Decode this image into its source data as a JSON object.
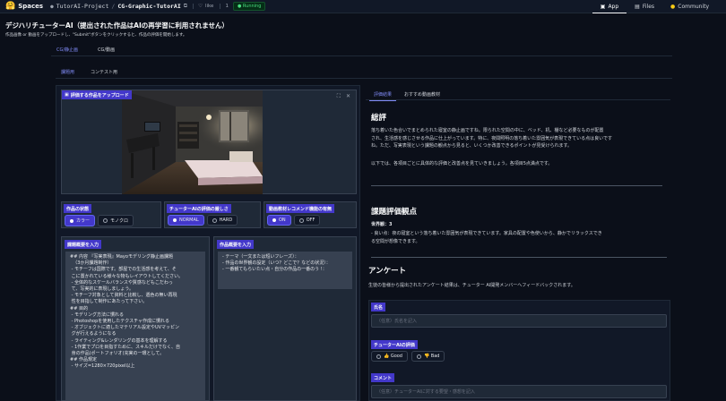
{
  "topbar": {
    "logo_icon": "hugging-face-emoji",
    "brand": "Spaces",
    "owner": "TutorAI-Project",
    "separator": "/",
    "space_name": "CG-Graphic-TutorAI",
    "copy_icon": "copy-icon",
    "like_label": "like",
    "like_count": "1",
    "status": "Running",
    "nav": [
      {
        "label": "App",
        "icon": "app-icon"
      },
      {
        "label": "Files",
        "icon": "files-icon"
      },
      {
        "label": "Community",
        "icon": "community-icon"
      }
    ]
  },
  "app": {
    "title": "デジハリチューターAI（提出された作品はAIの再学習に利用されません）",
    "description": "作品画像 or 動画をアップロードし、\"Submit\"ボタンをクリックすると、作品の評価を開始します。"
  },
  "tabs_main": [
    "CG/静止画",
    "CG/動画"
  ],
  "tabs_sub": [
    "課題用",
    "コンテスト用"
  ],
  "upload": {
    "label": "評価する作品をアップロード",
    "label_icon": "image-icon",
    "fullscreen_icon": "fullscreen-icon",
    "close_icon": "close-icon"
  },
  "radios": {
    "state": {
      "label": "作品の状態",
      "options": [
        "カラー",
        "モノクロ"
      ],
      "selected": 0
    },
    "strictness": {
      "label": "チューターAIの評価の厳しさ",
      "options": [
        "NORMAL",
        "HARD"
      ],
      "selected": 0
    },
    "video": {
      "label": "動画教材レコメンド機能の有無",
      "options": [
        "ON",
        "OFF"
      ],
      "selected": 0
    }
  },
  "assignment": {
    "label": "課題概要を入力",
    "text": "## 内容 『写実表現』Mayoモデリング静止画課題\n  （3か月課題制作）\n - モチーフは国際です。部屋での生活感を考えて、そ\n こに置かれている様々な物もレイアウトしてください。\n - 全体的なスケールバランスや質感などもこだわっ\n て、写実的に表現しましょう。\n - モチーフ対象として資料と比較し、遜色の無い再現\n 性を目指して制作にあたって下さい。\n## 目的\n - モデリング方法に慣れる\n - Photoshopを使用したテクスチャ作成に慣れる\n - オブジェクトに適したマテリアル設定やUVマッピン\n グが行えるようになる\n - ライティング&レンダリングの基本を理解する\n - 1作業でプロを目指すために、スキルだけでなく、自\n 身の作品(ポートフォリオ)充実の一環として。\n## 作品規定\n - サイズ=1280×720pixel以上"
  },
  "work": {
    "label": "作品概要を入力",
    "text": "- テーマ（一文または短いフレーズ）：\n- 作品の世界観の設定（いつ？どこで？などの状況）：\n- 一番観てもらいたい点・自分の作品の一番のう !："
  },
  "right_tabs": [
    "評価結果",
    "おすすめ動画教材"
  ],
  "result": {
    "h_summary": "総評",
    "summary": "落ち着いた色合いでまとめられた寝室の静止画ですね。限られた空間の中に、ベッド、机、棚など必要なものが配置\nされ、生活感を感じさせる作品に仕上がっています。特に、夜間照明の落ち着いた雰囲気が表現できている点は良いです\nね。ただ、写実表現という課題の観点から見ると、いくつか改善できるポイントが見受けられます。",
    "summary_end": "以下では、各項目ごとに具体的な評価と改善点を見ていきましょう。各項目5点満点です。",
    "h_points": "課題評価観点",
    "point_title": "世界観：3",
    "point_text": "- 良い点：夜の寝室という落ち着いた雰囲気が表現できています。家具の配置や色使いから、静かでリラックスでき\nる空間が想像できます。",
    "h_survey": "アンケート",
    "survey_desc": "生徒の皆様から提出されたアンケート結果は、チューター AI開発メンバーへフィードバックされます。",
    "name_label": "氏名",
    "name_placeholder": "（任意）氏名を記入",
    "eval_label": "チューターAIの評価",
    "good": "👍 Good",
    "bad": "👎 Bad",
    "comment_label": "コメント",
    "comment_placeholder": "（任意）チューターAIに対する要望・感想を記入"
  },
  "colors": {
    "bg": "#0b0f19",
    "panel": "#1f2937",
    "accent": "#4338ca",
    "accent_text": "#818cf8",
    "running": "#4ade80"
  }
}
